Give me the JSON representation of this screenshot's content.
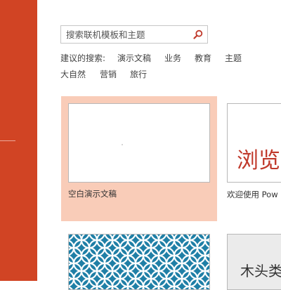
{
  "search": {
    "placeholder": "搜索联机模板和主题"
  },
  "suggested": {
    "label": "建议的搜索:",
    "terms": [
      "演示文稿",
      "业务",
      "教育",
      "主题",
      "大自然",
      "营销",
      "旅行"
    ]
  },
  "templates": [
    {
      "label": "空白演示文稿",
      "selected": true
    },
    {
      "label": "欢迎使用 Pow",
      "thumb_text": "浏览"
    },
    {
      "label": ""
    },
    {
      "label": "",
      "thumb_text": "木头类"
    }
  ],
  "colors": {
    "sidebar": "#d14424",
    "selected_tile": "#f9ccb8",
    "accent_text": "#c0392b",
    "pattern": "#1f7fa6"
  }
}
